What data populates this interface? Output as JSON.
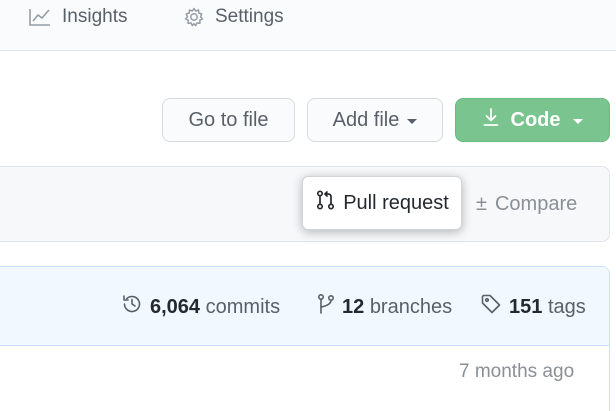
{
  "nav": {
    "insights_label": "Insights",
    "settings_label": "Settings"
  },
  "actions": {
    "goto_file_label": "Go to file",
    "add_file_label": "Add file",
    "code_label": "Code"
  },
  "compare_bar": {
    "pull_request_label": "Pull request",
    "compare_label": "Compare"
  },
  "stats": {
    "commits_count": "6,064",
    "commits_label": "commits",
    "branches_count": "12",
    "branches_label": "branches",
    "tags_count": "151",
    "tags_label": "tags"
  },
  "latest": {
    "age": "7 months ago"
  },
  "colors": {
    "code_button": "#7ac48f",
    "stats_header": "#f1f8ff",
    "muted_text": "#586069"
  },
  "icons": {
    "insights": "graph-icon",
    "settings": "gear-icon",
    "download": "download-icon",
    "pull_request": "git-pull-request-icon",
    "commits": "history-icon",
    "branches": "git-branch-icon",
    "tags": "tag-icon"
  }
}
